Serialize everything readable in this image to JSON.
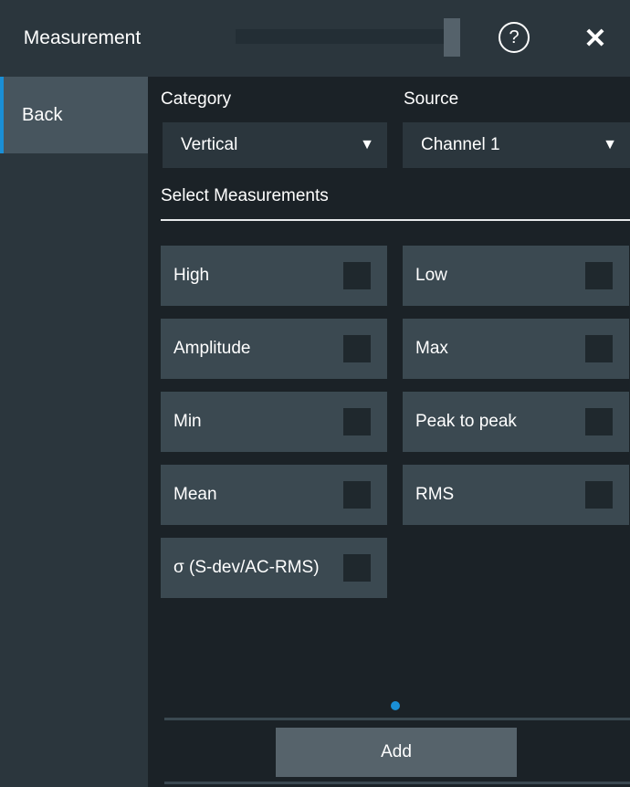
{
  "window": {
    "title": "Measurement",
    "help_symbol": "?",
    "close_symbol": "✕"
  },
  "sidebar": {
    "back_label": "Back"
  },
  "category": {
    "label": "Category",
    "value": "Vertical"
  },
  "source": {
    "label": "Source",
    "value": "Channel 1"
  },
  "select_section": {
    "title": "Select Measurements"
  },
  "measurements": [
    {
      "label": "High",
      "checked": false
    },
    {
      "label": "Low",
      "checked": false
    },
    {
      "label": "Amplitude",
      "checked": false
    },
    {
      "label": "Max",
      "checked": false
    },
    {
      "label": "Min",
      "checked": false
    },
    {
      "label": "Peak to peak",
      "checked": false
    },
    {
      "label": "Mean",
      "checked": false
    },
    {
      "label": "RMS",
      "checked": false
    },
    {
      "label": "σ (S-dev/AC-RMS)",
      "checked": false
    }
  ],
  "footer": {
    "add_label": "Add"
  },
  "colors": {
    "accent": "#1a8fd6",
    "background": "#1b2227",
    "panel": "#2b363d",
    "tile": "#3b4951"
  }
}
